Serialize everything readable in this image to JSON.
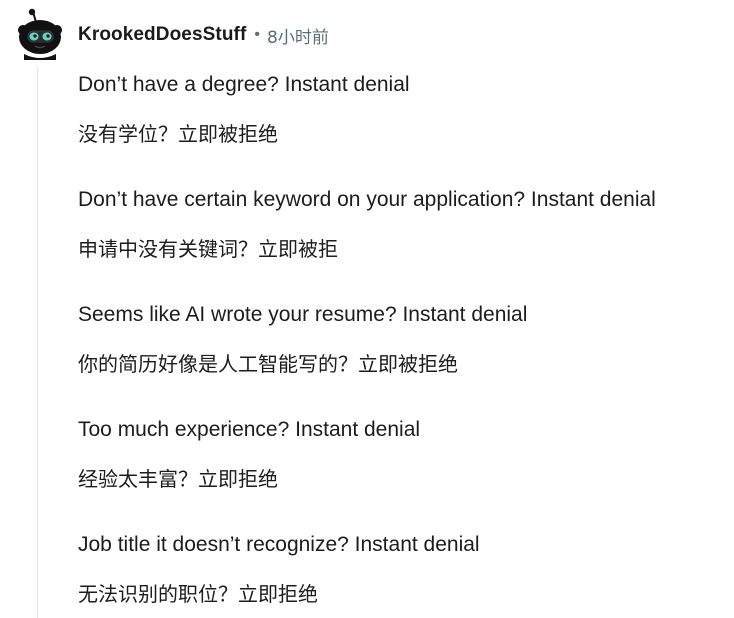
{
  "comment": {
    "author": "KrookedDoesStuff",
    "separator": "•",
    "time": "8小时前",
    "avatar_icon": "snoo-avatar-icon",
    "paragraphs": [
      {
        "en": "Don’t have a degree? Instant denial",
        "zh": "没有学位？立即被拒绝"
      },
      {
        "en": "Don’t have certain keyword on your application? Instant denial",
        "zh": "申请中没有关键词？立即被拒"
      },
      {
        "en": "Seems like AI wrote your resume? Instant denial",
        "zh": "你的简历好像是人工智能写的？立即被拒绝"
      },
      {
        "en": "Too much experience? Instant denial",
        "zh": "经验太丰富？立即拒绝"
      },
      {
        "en": "Job title it doesn’t recognize? Instant denial",
        "zh": "无法识别的职位？立即拒绝"
      }
    ]
  },
  "colors": {
    "text": "#1c1c1c",
    "meta": "#576f76",
    "thread_line": "#e4e6e8",
    "avatar_accent": "#5fd3c0"
  }
}
